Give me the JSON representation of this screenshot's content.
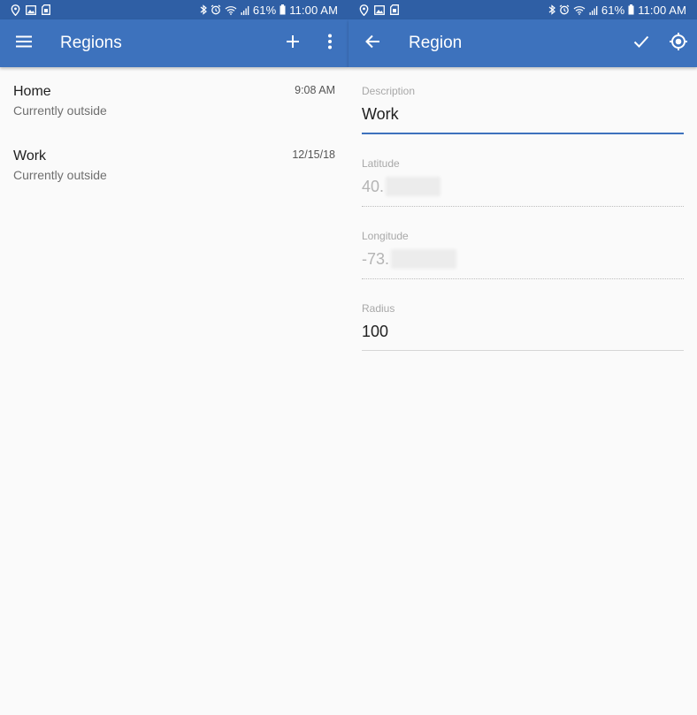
{
  "status_bar": {
    "battery": "61%",
    "time": "11:00 AM"
  },
  "left": {
    "title": "Regions",
    "items": [
      {
        "name": "Home",
        "status": "Currently outside",
        "time": "9:08 AM"
      },
      {
        "name": "Work",
        "status": "Currently outside",
        "time": "12/15/18"
      }
    ]
  },
  "right": {
    "title": "Region",
    "fields": {
      "description": {
        "label": "Description",
        "value": "Work"
      },
      "latitude": {
        "label": "Latitude",
        "value": "40."
      },
      "longitude": {
        "label": "Longitude",
        "value": "-73."
      },
      "radius": {
        "label": "Radius",
        "value": "100"
      }
    }
  },
  "colors": {
    "app_bar": "#3d72bd",
    "status_bar": "#2f5fa5",
    "accent": "#3d72bd",
    "background": "#fafafa"
  },
  "icons": [
    "location-pin-icon",
    "image-icon",
    "sd-card-icon",
    "bluetooth-icon",
    "alarm-icon",
    "wifi-icon",
    "signal-icon",
    "battery-icon",
    "menu-icon",
    "add-icon",
    "more-vert-icon",
    "back-arrow-icon",
    "check-icon",
    "my-location-icon"
  ]
}
